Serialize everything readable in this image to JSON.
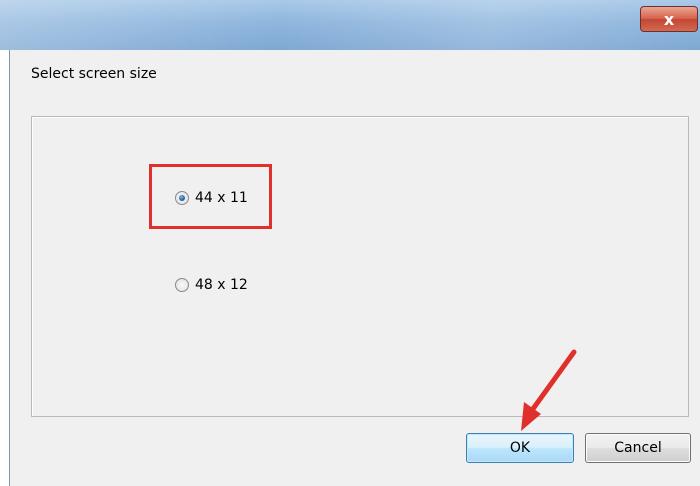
{
  "window": {
    "close_label": "x"
  },
  "dialog": {
    "prompt_label": "Select screen size",
    "options": [
      {
        "label": "44 x 11",
        "selected": true
      },
      {
        "label": "48 x 12",
        "selected": false
      }
    ],
    "ok_label": "OK",
    "cancel_label": "Cancel"
  },
  "annotations": {
    "highlight_color": "#e0302c",
    "arrow_color": "#e0302c"
  }
}
